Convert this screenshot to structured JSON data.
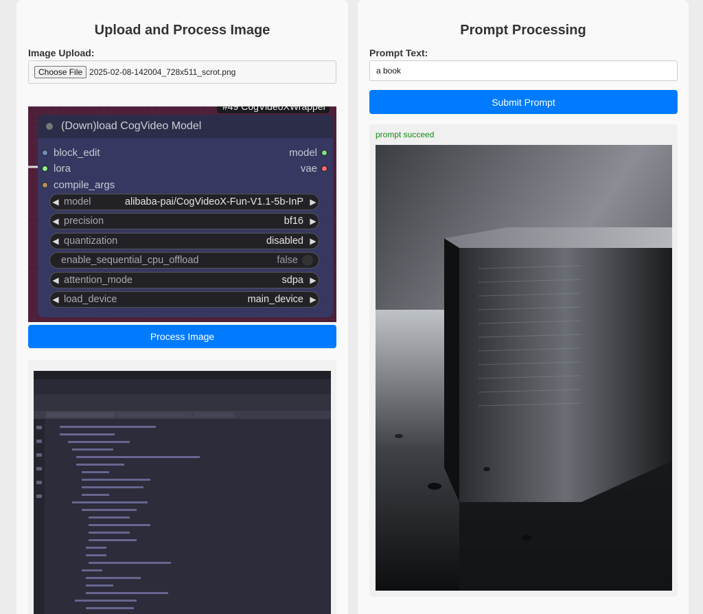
{
  "upload_panel": {
    "title": "Upload and Process Image",
    "image_upload_label": "Image Upload:",
    "choose_file_label": "Choose File",
    "file_name": "2025-02-08-142004_728x511_scrot.png",
    "process_button_label": "Process Image"
  },
  "node_preview": {
    "tag": "#49 CogVideoXWrapper",
    "title": "(Down)load CogVideo Model",
    "inputs": [
      "block_edit",
      "lora",
      "compile_args"
    ],
    "outputs": [
      "model",
      "vae"
    ],
    "widgets": [
      {
        "name": "model",
        "value": "alibaba-pai/CogVideoX-Fun-V1.1-5b-InP"
      },
      {
        "name": "precision",
        "value": "bf16"
      },
      {
        "name": "quantization",
        "value": "disabled"
      },
      {
        "name": "enable_sequential_cpu_offload",
        "value": "false"
      },
      {
        "name": "attention_mode",
        "value": "sdpa"
      },
      {
        "name": "load_device",
        "value": "main_device"
      }
    ]
  },
  "prompt_panel": {
    "title": "Prompt Processing",
    "prompt_label": "Prompt Text:",
    "prompt_value": "a book",
    "submit_button_label": "Submit Prompt",
    "status": "prompt succeed"
  },
  "colors": {
    "accent": "#007bff",
    "success": "#138a13"
  }
}
